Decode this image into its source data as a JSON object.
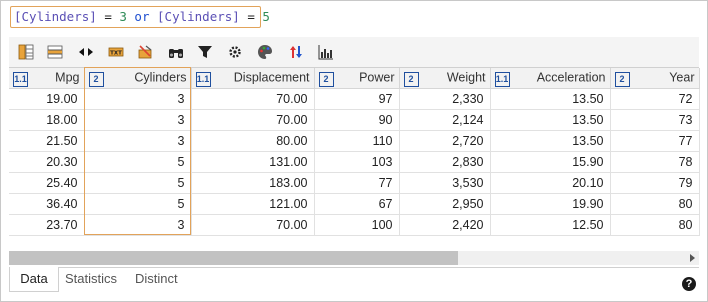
{
  "expression": {
    "col1": "[Cylinders]",
    "op1": " = ",
    "val1": "3",
    "kw": " or ",
    "col2": "[Cylinders]",
    "op2": " = ",
    "val2": "5"
  },
  "toolbar": {
    "icons": [
      "column-chooser-icon",
      "row-format-icon",
      "resize-columns-icon",
      "text-format-icon",
      "clear-format-icon",
      "find-icon",
      "filter-icon",
      "settings-icon",
      "color-palette-icon",
      "sort-icon",
      "chart-icon"
    ]
  },
  "grid": {
    "columns": [
      {
        "type": "1.1",
        "name": "Mpg"
      },
      {
        "type": "2",
        "name": "Cylinders"
      },
      {
        "type": "1.1",
        "name": "Displacement"
      },
      {
        "type": "2",
        "name": "Power"
      },
      {
        "type": "2",
        "name": "Weight"
      },
      {
        "type": "1.1",
        "name": "Acceleration"
      },
      {
        "type": "2",
        "name": "Year"
      }
    ],
    "rows": [
      [
        "19.00",
        "3",
        "70.00",
        "97",
        "2,330",
        "13.50",
        "72"
      ],
      [
        "18.00",
        "3",
        "70.00",
        "90",
        "2,124",
        "13.50",
        "73"
      ],
      [
        "21.50",
        "3",
        "80.00",
        "110",
        "2,720",
        "13.50",
        "77"
      ],
      [
        "20.30",
        "5",
        "131.00",
        "103",
        "2,830",
        "15.90",
        "78"
      ],
      [
        "25.40",
        "5",
        "183.00",
        "77",
        "3,530",
        "20.10",
        "79"
      ],
      [
        "36.40",
        "5",
        "121.00",
        "67",
        "2,950",
        "19.90",
        "80"
      ],
      [
        "23.70",
        "3",
        "70.00",
        "100",
        "2,420",
        "12.50",
        "80"
      ]
    ]
  },
  "tabs": [
    "Data",
    "Statistics",
    "Distinct"
  ],
  "active_tab": "Data",
  "help": "?",
  "colors": {
    "accent": "#e2a35a",
    "type_badge": "#1f4f9e"
  }
}
